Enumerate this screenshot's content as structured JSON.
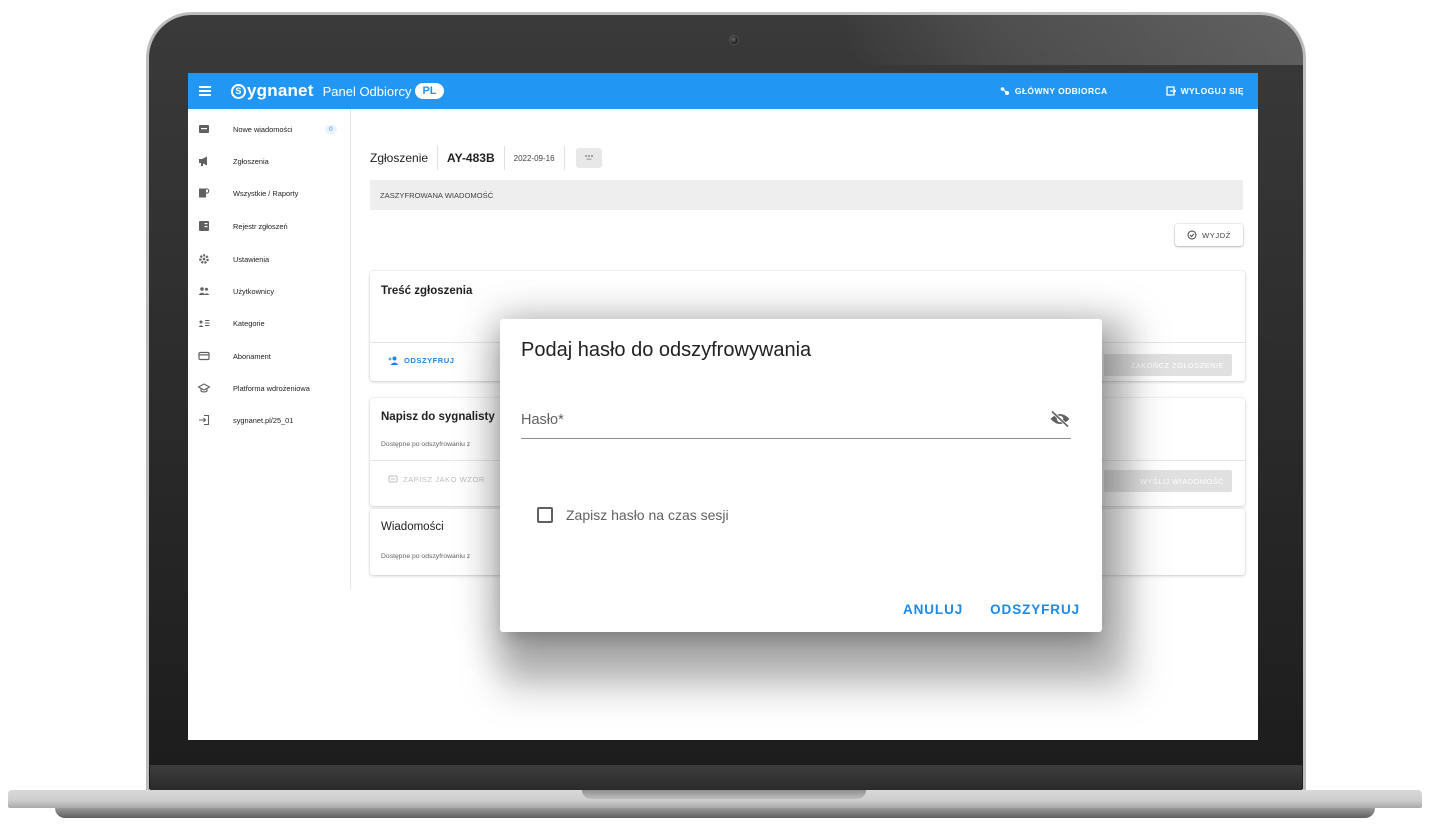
{
  "colors": {
    "primary": "#2196f3",
    "action_blue": "#1e88e5",
    "disabled": "#bdbdbd",
    "frame_dark": "#1c1c1c",
    "frame_silver": "#d0d0d0"
  },
  "appbar": {
    "brand": "ygnanet",
    "brand_initial": "S",
    "panel_label": "Panel Odbiorcy",
    "lang": "PL",
    "main_recipient_label": "GŁÓWNY ODBIORCA",
    "logout_label": "WYLOGUJ SIĘ"
  },
  "sidebar": {
    "items": [
      {
        "label": "Nowe wiadomości",
        "icon": "inbox-icon",
        "count": "0"
      },
      {
        "label": "Zgłoszenia",
        "icon": "megaphone-icon"
      },
      {
        "label": "Wszystkie / Raporty",
        "icon": "report-search-icon"
      },
      {
        "label": "Rejestr zgłoszeń",
        "icon": "register-book-icon"
      },
      {
        "label": "Ustawienia",
        "icon": "gear-icon"
      },
      {
        "label": "Użytkownicy",
        "icon": "users-icon"
      },
      {
        "label": "Kategorie",
        "icon": "category-list-icon"
      },
      {
        "label": "Abonament",
        "icon": "credit-card-icon"
      },
      {
        "label": "Platforma wdrożeniowa",
        "icon": "graduation-cap-icon"
      },
      {
        "label": "sygnanet.pl/25_01",
        "icon": "external-login-icon"
      }
    ]
  },
  "case": {
    "word": "Zgłoszenie",
    "id": "AY-483B",
    "date": "2022-09-16",
    "encrypted_label": "ZASZYFROWANA WIADOMOŚĆ",
    "exit_label": "WYJDŹ"
  },
  "cards": {
    "content": {
      "title": "Treść zgłoszenia",
      "decrypt_label": "ODSZYFRUJ",
      "finish_label": "ZAKOŃCZ ZGŁOSZENIE"
    },
    "write": {
      "title": "Napisz do sygnalisty",
      "subtitle": "Dostępne po odszyfrowaniu z",
      "save_template_label": "ZAPISZ JAKO WZOR",
      "send_label": "WYŚLIJ WIADOMOŚĆ"
    },
    "messages": {
      "title": "Wiadomości",
      "subtitle": "Dostępne po odszyfrowaniu z"
    }
  },
  "dialog": {
    "title": "Podaj hasło do odszyfrowywania",
    "password_label": "Hasło*",
    "password_value": "",
    "remember_label": "Zapisz hasło na czas sesji",
    "remember_checked": false,
    "cancel_label": "ANULUJ",
    "confirm_label": "ODSZYFRUJ"
  }
}
